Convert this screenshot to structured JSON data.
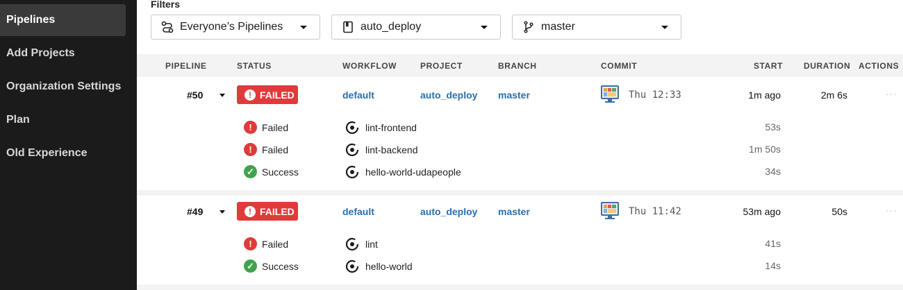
{
  "sidebar": {
    "items": [
      {
        "label": "Pipelines",
        "active": true
      },
      {
        "label": "Add Projects"
      },
      {
        "label": "Organization Settings"
      },
      {
        "label": "Plan"
      },
      {
        "label": "Old Experience"
      }
    ]
  },
  "filters": {
    "label": "Filters",
    "pipelines": "Everyone’s Pipelines",
    "project": "auto_deploy",
    "branch": "master"
  },
  "table": {
    "headers": {
      "pipeline": "PIPELINE",
      "status": "STATUS",
      "workflow": "WORKFLOW",
      "project": "PROJECT",
      "branch": "BRANCH",
      "commit": "COMMIT",
      "start": "START",
      "duration": "DURATION",
      "actions": "ACTIONS"
    },
    "pipelines": [
      {
        "number": "#50",
        "status": "FAILED",
        "workflow": "default",
        "project": "auto_deploy",
        "branch": "master",
        "commit_time": "Thu 12:33",
        "start": "1m ago",
        "duration": "2m 6s",
        "actions": "···",
        "jobs": [
          {
            "status": "Failed",
            "name": "lint-frontend",
            "duration": "53s"
          },
          {
            "status": "Failed",
            "name": "lint-backend",
            "duration": "1m 50s"
          },
          {
            "status": "Success",
            "name": "hello-world-udapeople",
            "duration": "34s"
          }
        ]
      },
      {
        "number": "#49",
        "status": "FAILED",
        "workflow": "default",
        "project": "auto_deploy",
        "branch": "master",
        "commit_time": "Thu 11:42",
        "start": "53m ago",
        "duration": "50s",
        "actions": "···",
        "jobs": [
          {
            "status": "Failed",
            "name": "lint",
            "duration": "41s"
          },
          {
            "status": "Success",
            "name": "hello-world",
            "duration": "14s"
          }
        ]
      }
    ]
  },
  "colors": {
    "failed": "#e13a3a",
    "success": "#3fa34d",
    "link": "#2a6fad",
    "sidebar_bg": "#1b1b1b"
  },
  "icons": {
    "failed": "exclamation-circle-icon",
    "success": "check-circle-icon",
    "job": "job-ring-icon",
    "filter_pipelines": "pipelines-icon",
    "filter_project": "bookmark-icon",
    "filter_branch": "branch-icon"
  }
}
